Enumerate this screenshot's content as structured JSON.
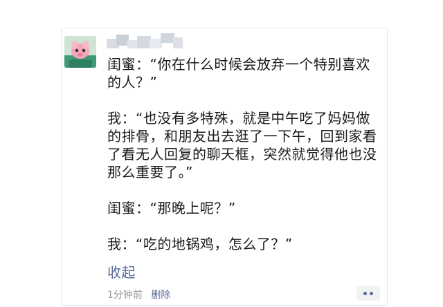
{
  "post": {
    "nickname_icon": "blurred-nickname",
    "avatar_icon": "avatar-image",
    "paragraphs": [
      "闺蜜：“你在什么时候会放弃一个特别喜欢的人？”",
      "我：“也没有多特殊，就是中午吃了妈妈做的排骨，和朋友出去逛了一下午，回到家看了看无人回复的聊天框，突然就觉得他也没那么重要了。”",
      "闺蜜：“那晚上呢？”",
      "我：“吃的地锅鸡，怎么了？”"
    ],
    "collapse_label": "收起",
    "timestamp": "1分钟前",
    "delete_label": "删除",
    "more_icon": "more-dots-icon"
  },
  "colors": {
    "link": "#576b95",
    "meta": "#9a9a9a",
    "text": "#1a1a1a"
  }
}
